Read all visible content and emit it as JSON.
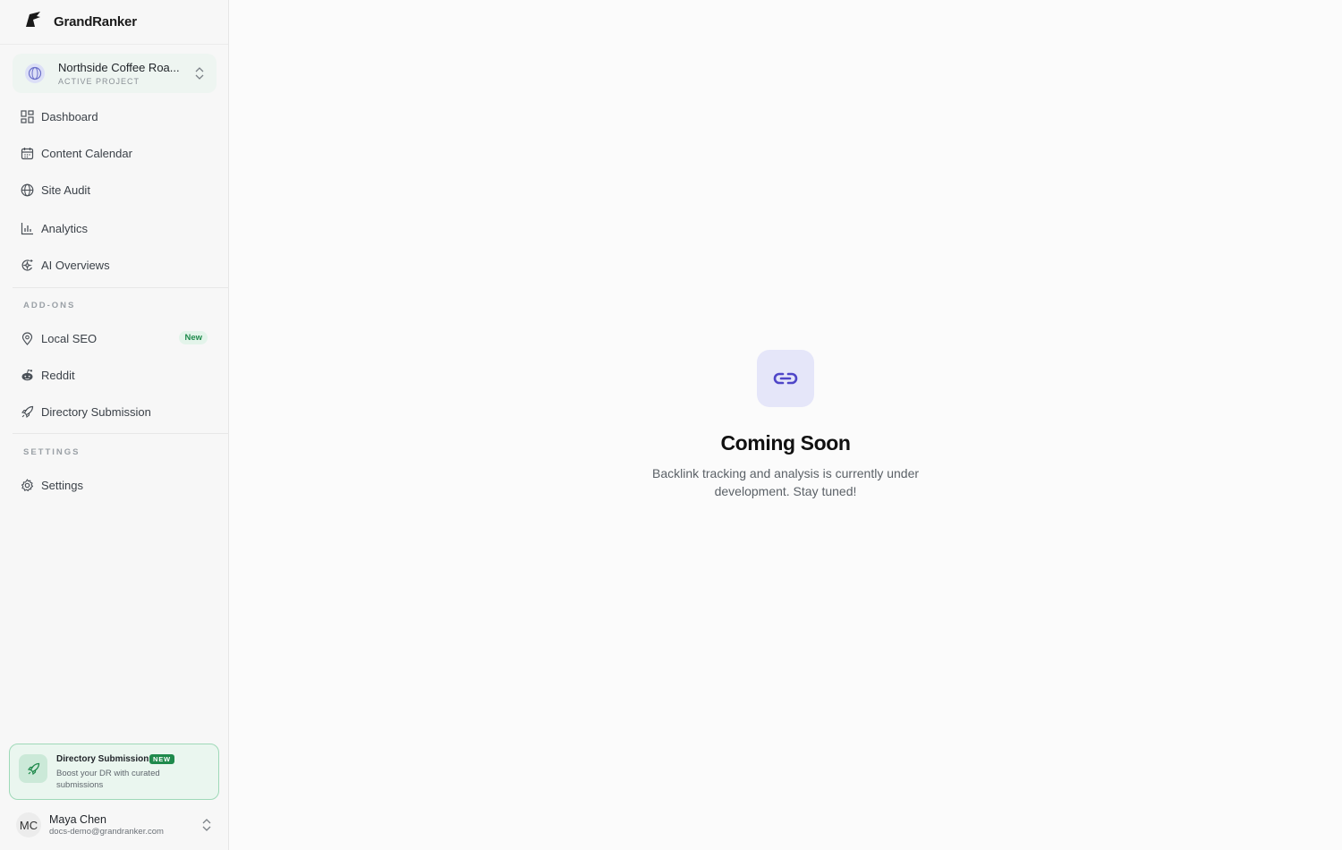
{
  "brand": {
    "name": "GrandRanker"
  },
  "project": {
    "name": "Northside Coffee Roa...",
    "subtitle": "ACTIVE PROJECT"
  },
  "nav": {
    "main": [
      {
        "label": "Dashboard",
        "icon": "grid-icon"
      },
      {
        "label": "Content Calendar",
        "icon": "calendar-icon"
      },
      {
        "label": "Site Audit",
        "icon": "globe-icon"
      },
      {
        "label": "Analytics",
        "icon": "bar-chart-icon"
      },
      {
        "label": "AI Overviews",
        "icon": "ai-icon"
      }
    ],
    "addons_label": "ADD-ONS",
    "addons": [
      {
        "label": "Local SEO",
        "icon": "map-pin-icon",
        "badge": "New"
      },
      {
        "label": "Reddit",
        "icon": "reddit-icon"
      },
      {
        "label": "Directory Submission",
        "icon": "rocket-icon"
      }
    ],
    "settings_label": "SETTINGS",
    "settings": [
      {
        "label": "Settings",
        "icon": "gear-icon"
      }
    ]
  },
  "promo": {
    "title": "Directory Submission",
    "badge": "NEW",
    "description": "Boost your DR with curated submissions"
  },
  "user": {
    "initials": "MC",
    "name": "Maya Chen",
    "email": "docs-demo@grandranker.com"
  },
  "main": {
    "title": "Coming Soon",
    "description": "Backlink tracking and analysis is currently under development. Stay tuned!",
    "icon": "link-icon"
  },
  "colors": {
    "accent_green": "#1f8a4c",
    "accent_indigo": "#4f46c8"
  }
}
